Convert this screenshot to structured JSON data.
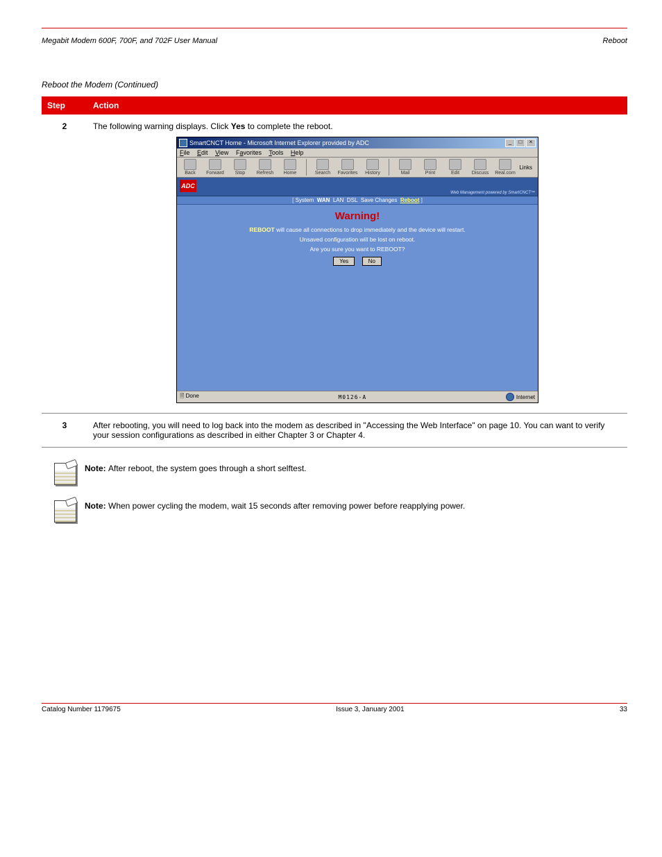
{
  "header": {
    "left": "Megabit Modem 600F, 700F, and 702F User Manual",
    "right": "Reboot"
  },
  "procedure_title": "Reboot the Modem (Continued)",
  "table": {
    "col_step": "Step",
    "col_action": "Action"
  },
  "step2": {
    "num": "2",
    "text_before": "The following warning displays. Click ",
    "bold": "Yes",
    "text_after": " to complete the reboot."
  },
  "screenshot": {
    "title": "SmartCNCT Home - Microsoft Internet Explorer provided by ADC",
    "menu": {
      "file": "File",
      "edit": "Edit",
      "view": "View",
      "fav": "Favorites",
      "tools": "Tools",
      "help": "Help"
    },
    "tb": {
      "back": "Back",
      "forward": "Forward",
      "stop": "Stop",
      "refresh": "Refresh",
      "home": "Home",
      "search": "Search",
      "favorites": "Favorites",
      "history": "History",
      "mail": "Mail",
      "print": "Print",
      "edit": "Edit",
      "discuss": "Discuss",
      "real": "Real.com"
    },
    "links_label": "Links",
    "adc_logo": "ADC",
    "adc_caption": "Web Management powered by SmartCNCT™",
    "nav": {
      "system": "System",
      "wan": "WAN",
      "lan": "LAN",
      "dsl": "DSL",
      "save": "Save Changes",
      "reboot": "Reboot"
    },
    "warning": "Warning!",
    "line1_pre": "REBOOT",
    "line1_rest": " will cause all connections to drop immediately and the device will restart.",
    "line2": "Unsaved configuration will be lost on reboot.",
    "line3": "Are you sure you want to REBOOT?",
    "yes": "Yes",
    "no": "No",
    "status_done": "Done",
    "status_center": "M0126-A",
    "status_zone": "Internet"
  },
  "step3": {
    "num": "3",
    "text": "After rebooting, you will need to log back into the modem as described in \"Accessing the Web Interface\" on page 10. You can want to verify your session configurations as described in either Chapter 3 or Chapter 4."
  },
  "note1": {
    "label": "Note: ",
    "text": "After reboot, the system goes through a short selftest."
  },
  "note2": {
    "label": "Note: ",
    "text": "When power cycling the modem, wait 15 seconds after removing power before reapplying power."
  },
  "footer": {
    "left": "Catalog Number 1179675",
    "center": "Issue 3, January 2001",
    "right": "33"
  }
}
